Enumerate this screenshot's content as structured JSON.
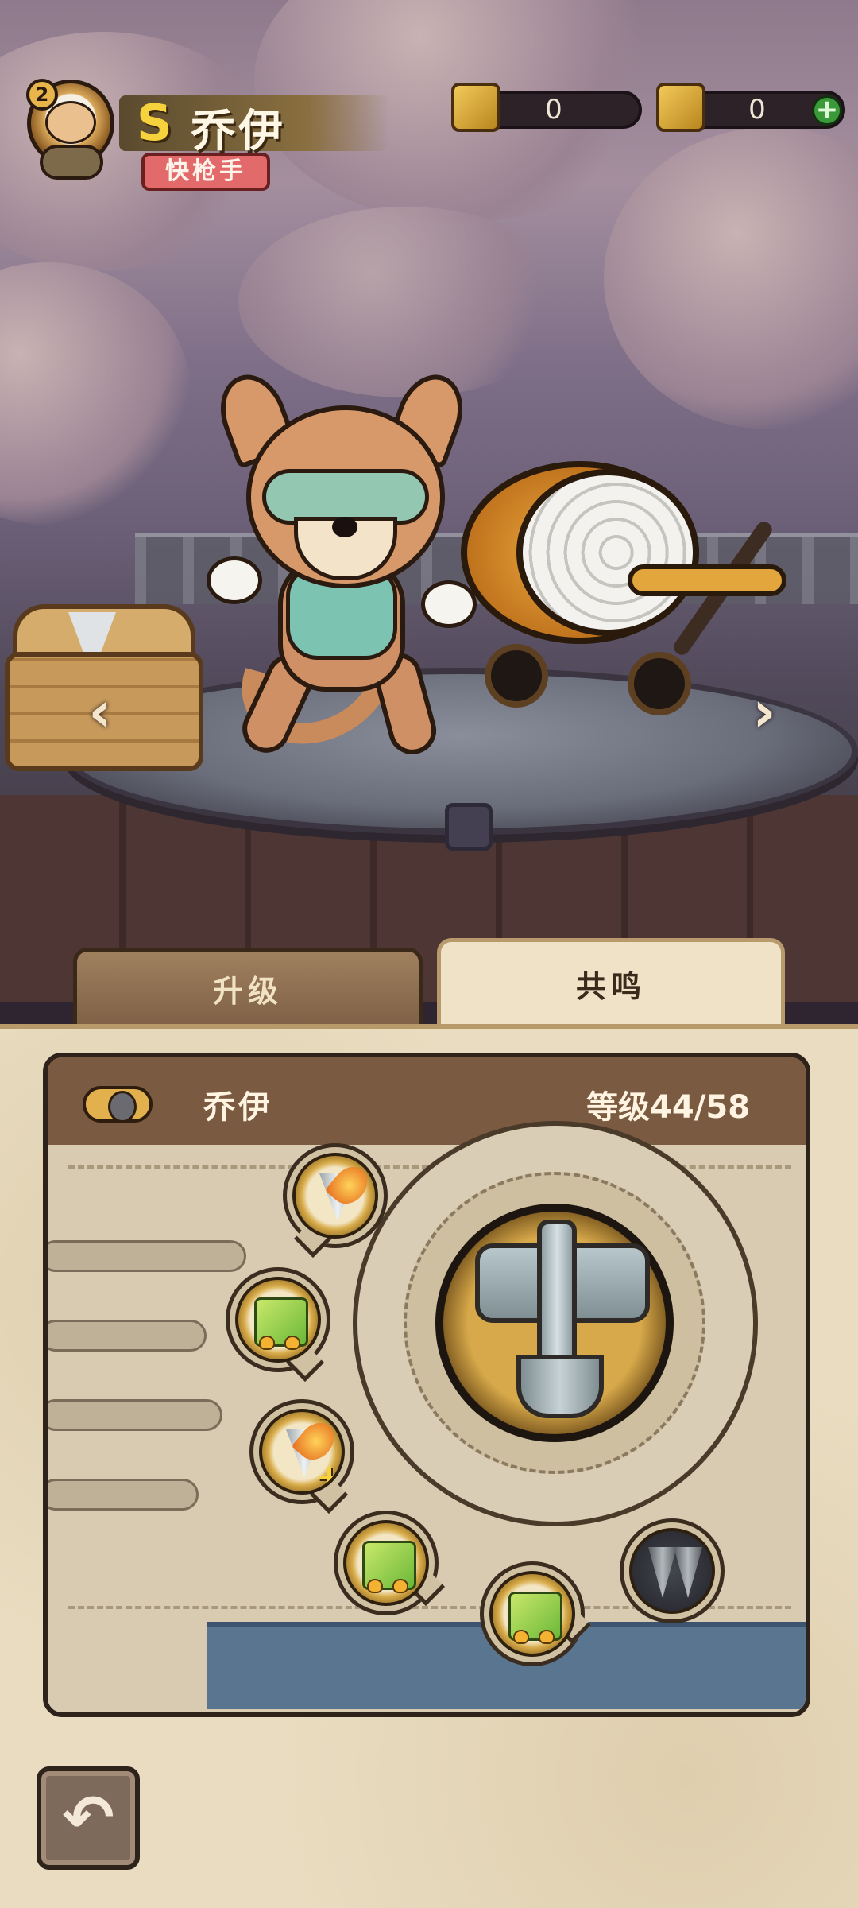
{
  "header": {
    "avatar_level": "2",
    "grade": "S",
    "hero_name": "乔伊",
    "hero_class": "快枪手"
  },
  "currencies": [
    {
      "icon": "ticket-coin-icon",
      "value": "0"
    },
    {
      "icon": "gold-coin-icon",
      "value": "0"
    }
  ],
  "scene": {
    "prev_arrow": "‹",
    "next_arrow": "›"
  },
  "tabs": [
    {
      "label": "升级",
      "active": false
    },
    {
      "label": "共鸣",
      "active": true
    }
  ],
  "resonance": {
    "name": "乔伊",
    "level_label": "等级",
    "level": "44/58"
  },
  "slots": [
    {
      "icon": "flaming-drill-icon"
    },
    {
      "icon": "green-card-hearts-icon"
    },
    {
      "icon": "flaming-drill-plus-icon"
    },
    {
      "icon": "green-card-hearts-icon"
    },
    {
      "icon": "green-card-hearts-icon"
    },
    {
      "icon": "twin-drills-locked-icon"
    }
  ],
  "back_icon": "↶",
  "colors": {
    "grade": "#f6d23c",
    "class_badge": "#e36a6a",
    "plus_button": "#3a9a3a",
    "active_tab": "#efe2c6",
    "inactive_tab": "#8e6e52"
  }
}
